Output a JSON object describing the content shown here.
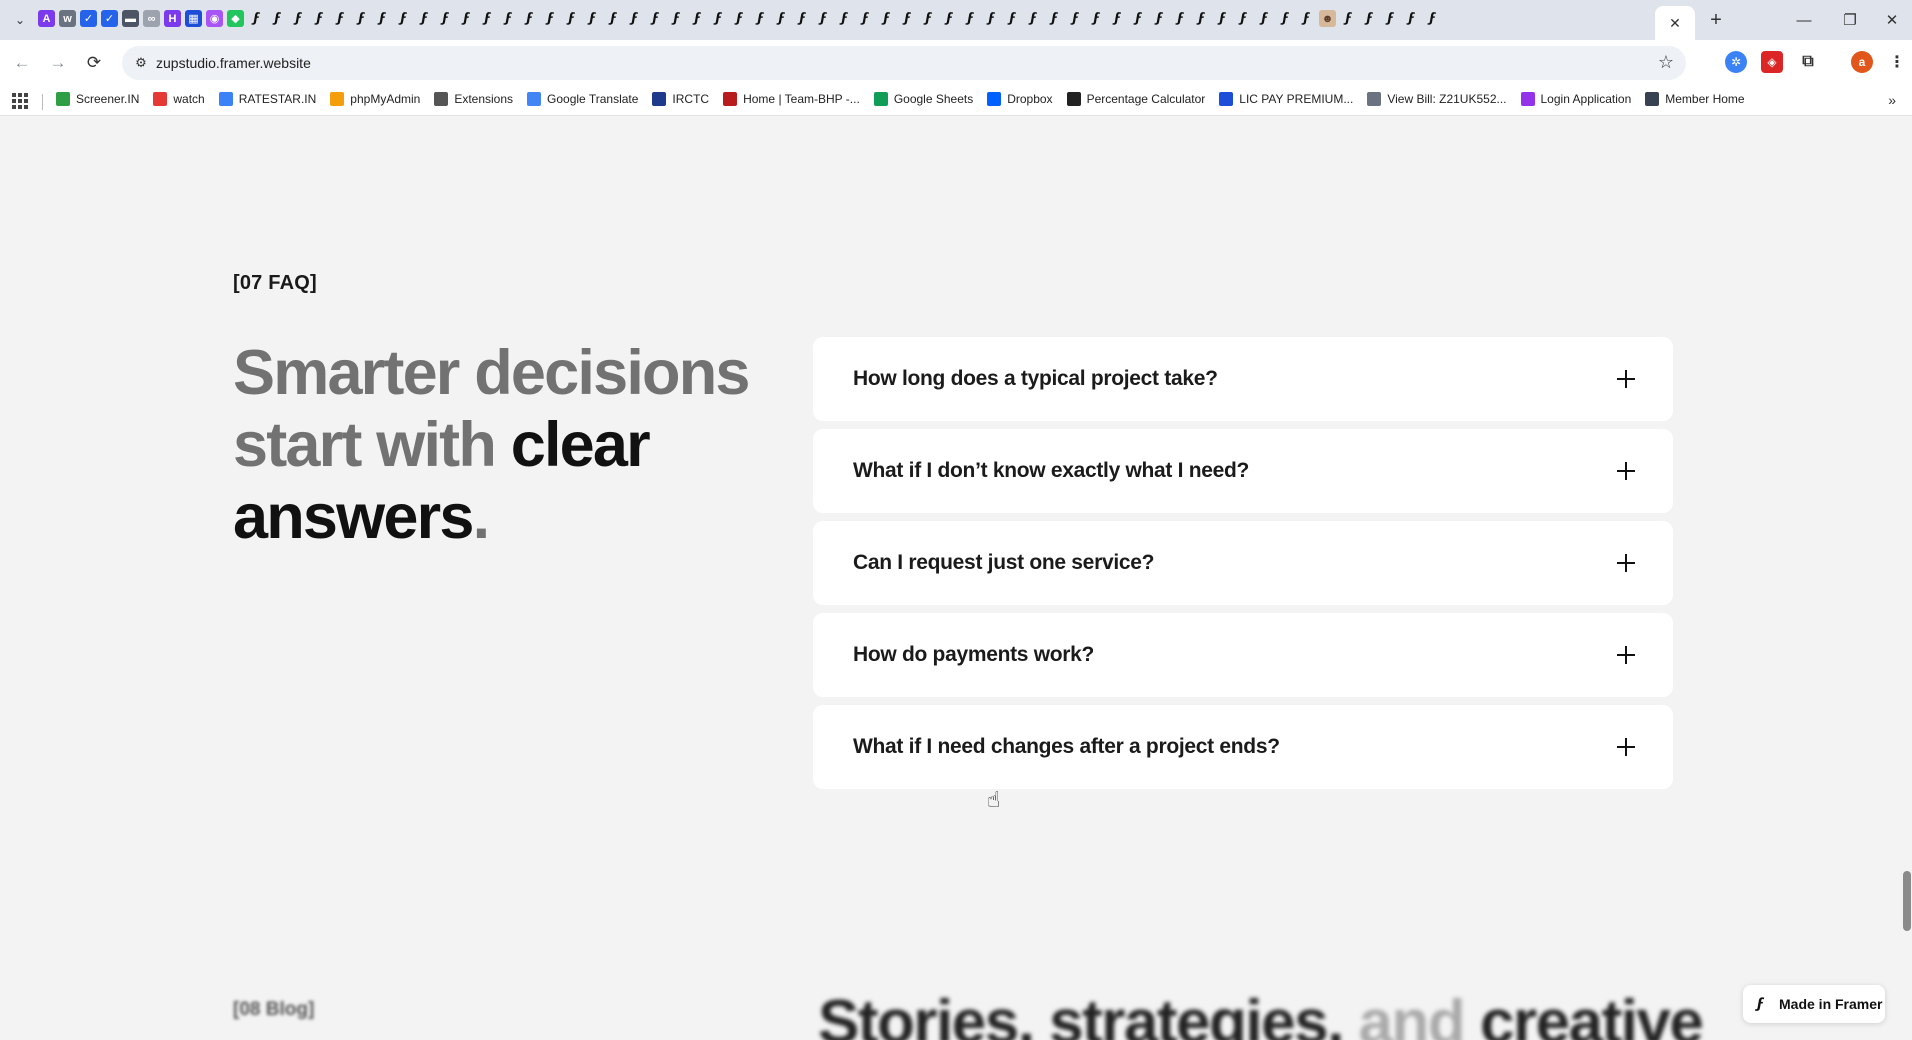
{
  "browser": {
    "url": "zupstudio.framer.website",
    "tab_close_glyph": "✕",
    "new_tab_glyph": "+",
    "window_controls": [
      "—",
      "❐",
      "✕"
    ],
    "nav": {
      "back": "←",
      "forward": "→",
      "reload": "⟳"
    },
    "star_glyph": "☆",
    "profile_letter": "a",
    "more_glyph": "⋮",
    "bookmarks_overflow": "»"
  },
  "bookmarks": [
    {
      "label": "Screener.IN",
      "color": "#2f9e44"
    },
    {
      "label": "watch",
      "color": "#e53935"
    },
    {
      "label": "RATESTAR.IN",
      "color": "#3b82f6"
    },
    {
      "label": "phpMyAdmin",
      "color": "#f59e0b"
    },
    {
      "label": "Extensions",
      "color": "#555555"
    },
    {
      "label": "Google Translate",
      "color": "#4285f4"
    },
    {
      "label": "IRCTC",
      "color": "#1e3a8a"
    },
    {
      "label": "Home | Team-BHP -...",
      "color": "#b91c1c"
    },
    {
      "label": "Google Sheets",
      "color": "#0f9d58"
    },
    {
      "label": "Dropbox",
      "color": "#0061fe"
    },
    {
      "label": "Percentage Calculator",
      "color": "#222222"
    },
    {
      "label": "LIC PAY PREMIUM...",
      "color": "#1d4ed8"
    },
    {
      "label": "View Bill: Z21UK552...",
      "color": "#6b7280"
    },
    {
      "label": "Login Application",
      "color": "#9333ea"
    },
    {
      "label": "Member Home",
      "color": "#374151"
    }
  ],
  "faq": {
    "section_tag": "[07 FAQ]",
    "headline": {
      "grey_1": "Smarter decisions",
      "grey_2": "start with ",
      "dark_1": "clear",
      "dark_2": "answers",
      "period": "."
    },
    "items": [
      {
        "question": "How long does a typical project take?"
      },
      {
        "question": "What if I don’t know exactly what I need?"
      },
      {
        "question": "Can I request just one service?"
      },
      {
        "question": "How do payments work?"
      },
      {
        "question": "What if I need changes after a project ends?"
      }
    ]
  },
  "blog": {
    "section_tag": "[08 Blog]",
    "headline_dark": "Stories, strategies, ",
    "headline_fade": "and",
    "headline_dark_2": " creative"
  },
  "badge": {
    "label": "Made in Framer"
  },
  "colors": {
    "background": "#f3f3f3",
    "card": "#ffffff",
    "headline_grey": "#727272",
    "headline_dark": "#111111"
  }
}
